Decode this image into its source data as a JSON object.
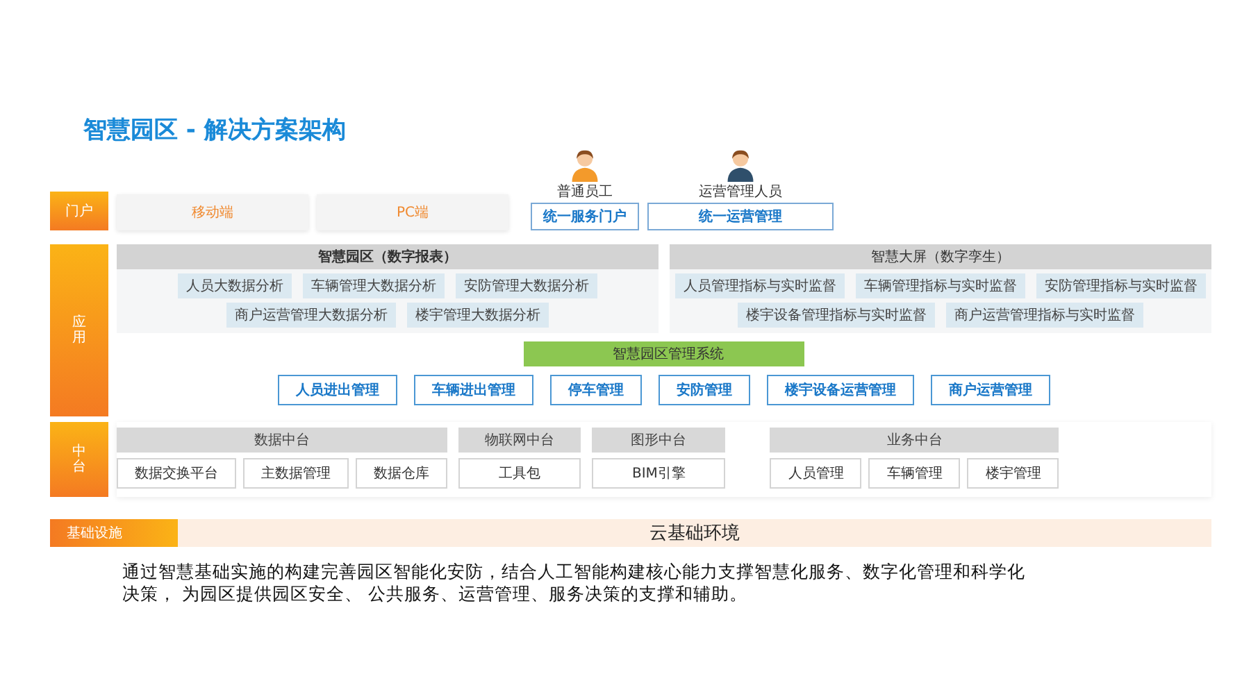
{
  "title": "智慧园区 - 解决方案架构",
  "layers": [
    {
      "kind": "portal",
      "label": "门户",
      "channels": [
        "移动端",
        "PC端"
      ],
      "users": [
        {
          "role": "普通员工",
          "portal": "统一服务门户"
        },
        {
          "role": "运营管理人员",
          "portal": "统一运营管理"
        }
      ]
    },
    {
      "kind": "application",
      "label": "应用",
      "panels": [
        {
          "title": "智慧园区（数字报表）",
          "bold": true,
          "rows": [
            [
              "人员大数据分析",
              "车辆管理大数据分析",
              "安防管理大数据分析"
            ],
            [
              "商户运营管理大数据分析",
              "楼宇管理大数据分析"
            ]
          ]
        },
        {
          "title": "智慧大屏（数字孪生）",
          "bold": false,
          "rows": [
            [
              "人员管理指标与实时监督",
              "车辆管理指标与实时监督",
              "安防管理指标与实时监督"
            ],
            [
              "楼宇设备管理指标与实时监督",
              "商户运营管理指标与实时监督"
            ]
          ]
        }
      ],
      "system": "智慧园区管理系统",
      "modules": [
        "人员进出管理",
        "车辆进出管理",
        "停车管理",
        "安防管理",
        "楼宇设备运营管理",
        "商户运营管理"
      ]
    },
    {
      "kind": "middle",
      "label": "中台",
      "groups": [
        {
          "title": "数据中台",
          "items": [
            "数据交换平台",
            "主数据管理",
            "数据仓库"
          ]
        },
        {
          "title": "物联网中台",
          "items": [
            "工具包"
          ]
        },
        {
          "title": "图形中台",
          "items": [
            "BIM引擎"
          ]
        },
        {
          "title": "业务中台",
          "items": [
            "人员管理",
            "车辆管理",
            "楼宇管理"
          ]
        }
      ]
    },
    {
      "kind": "infrastructure",
      "label": "基础设施",
      "content": "云基础环境"
    }
  ],
  "description": "通过智慧基础实施的构建完善园区智能化安防，结合人工智能构建核心能力支撑智慧化服务、数字化管理和科学化决策， 为园区提供园区安全、 公共服务、运营管理、服务决策的支撑和辅助。"
}
